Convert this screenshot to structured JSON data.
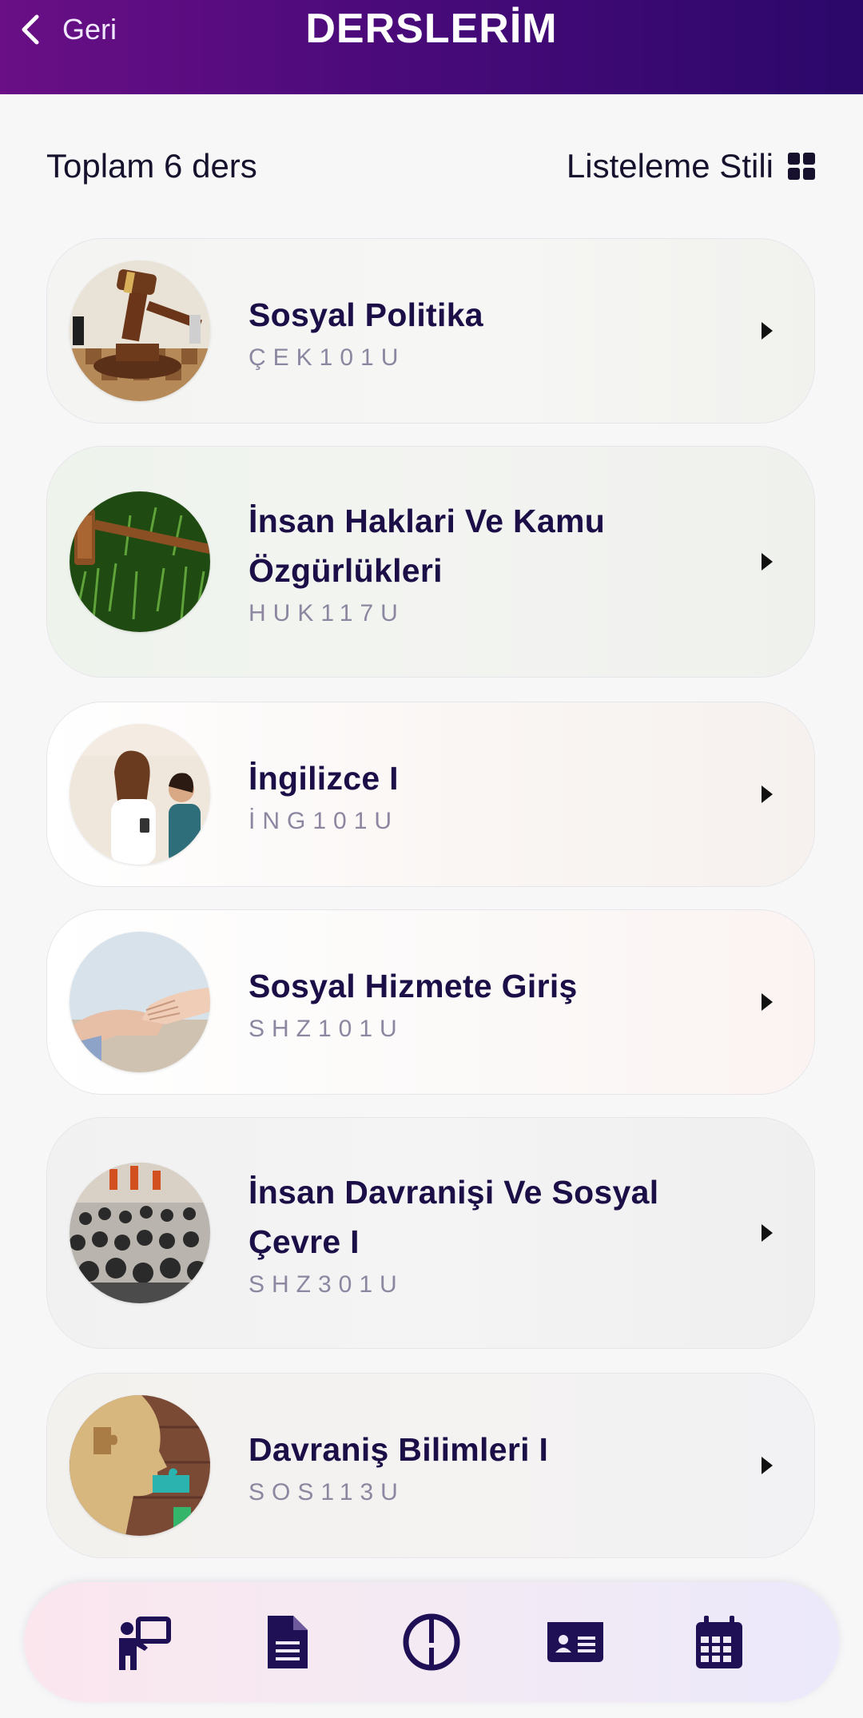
{
  "header": {
    "back_label": "Geri",
    "title": "DERSLERİM"
  },
  "summary": {
    "total_label": "Toplam 6 ders",
    "style_label": "Listeleme Stili"
  },
  "courses": [
    {
      "name": "Sosyal Politika",
      "code": "ÇEK101U",
      "thumb_icon": "gavel-chess-image"
    },
    {
      "name": "İnsan Haklari Ve Kamu Özgürlükleri",
      "code": "HUK117U",
      "thumb_icon": "gavel-grass-image"
    },
    {
      "name": "İngilizce I",
      "code": "İNG101U",
      "thumb_icon": "students-talking-image"
    },
    {
      "name": "Sosyal Hizmete Giriş",
      "code": "SHZ101U",
      "thumb_icon": "holding-hands-image"
    },
    {
      "name": "İnsan Davranişi Ve Sosyal Çevre I",
      "code": "SHZ301U",
      "thumb_icon": "crowd-image"
    },
    {
      "name": "Davraniş Bilimleri I",
      "code": "SOS113U",
      "thumb_icon": "puzzle-head-image"
    }
  ],
  "bottom_nav": [
    {
      "icon": "presenter-board-icon"
    },
    {
      "icon": "document-icon"
    },
    {
      "icon": "half-circle-logo-icon"
    },
    {
      "icon": "id-card-icon"
    },
    {
      "icon": "calendar-icon"
    }
  ],
  "colors": {
    "header_start": "#6a0f86",
    "header_end": "#2b086a",
    "accent_text": "#1c0f48",
    "code_text": "#8c86a0"
  }
}
